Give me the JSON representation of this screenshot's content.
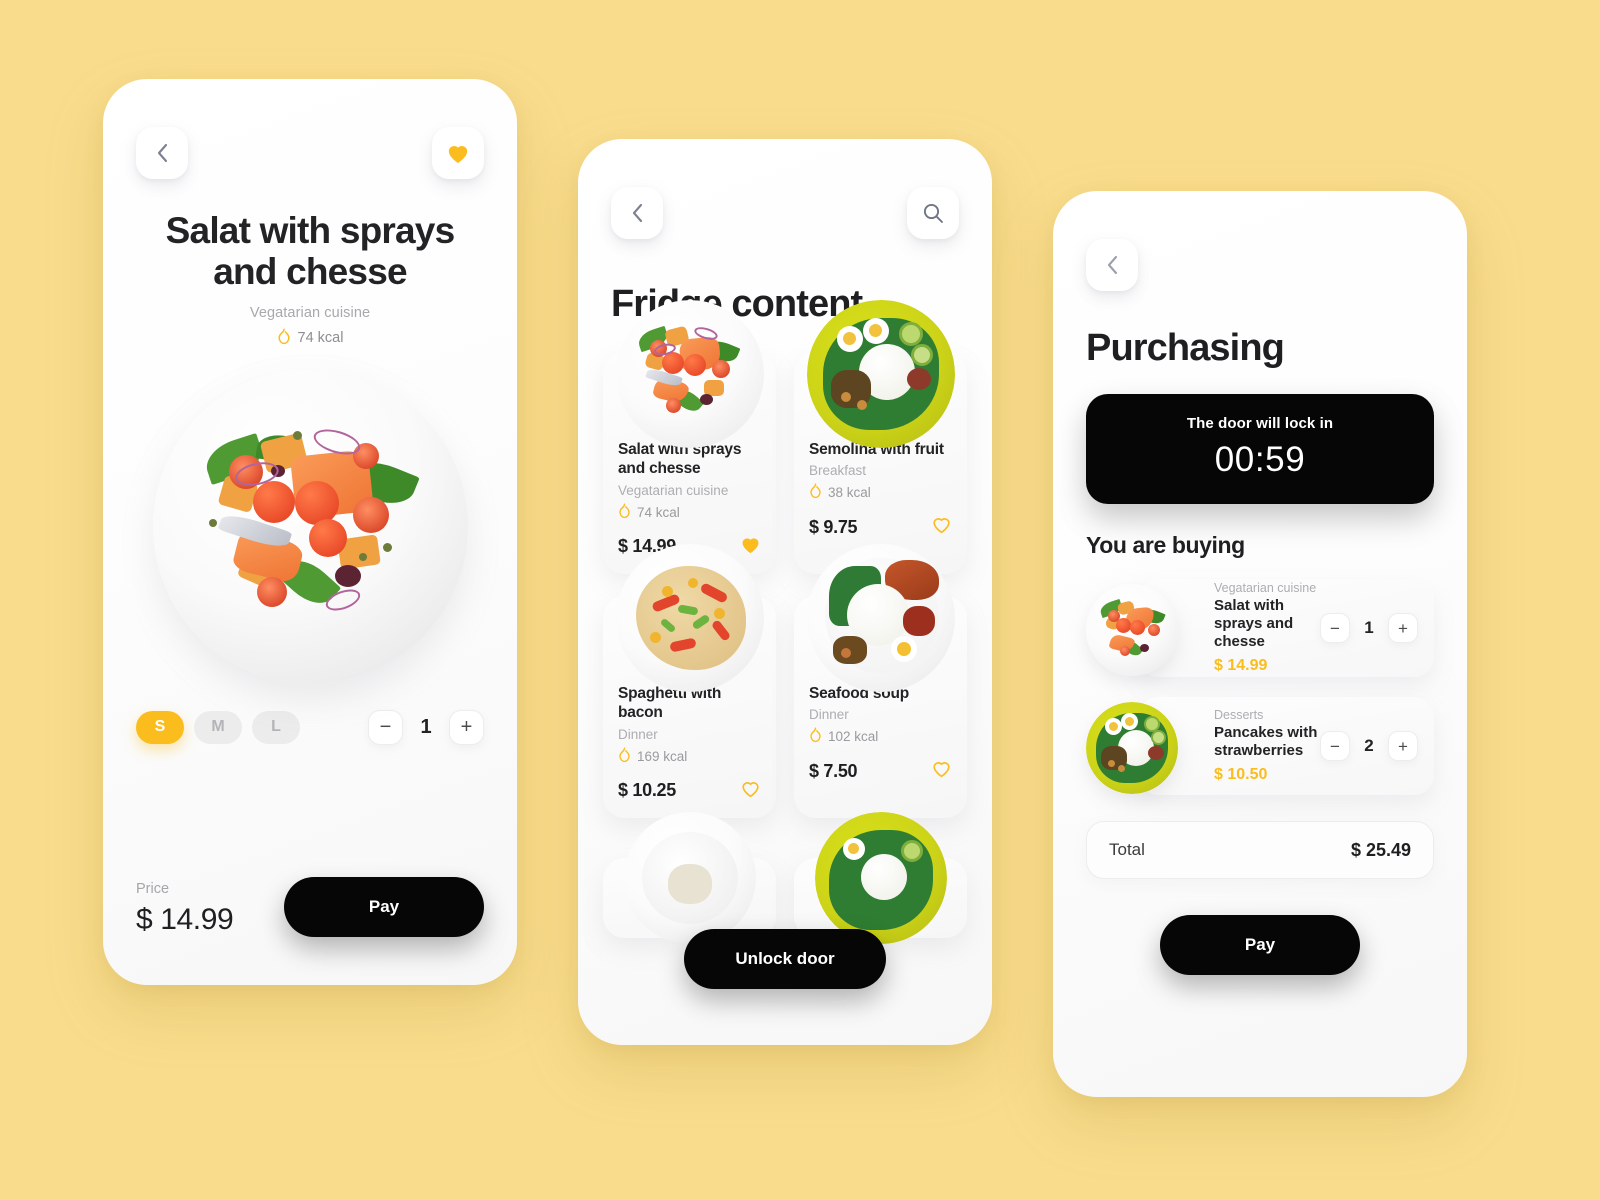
{
  "theme": {
    "background": "#f9dd8d",
    "accent": "#fbbc1e",
    "dark": "#060606",
    "text": "#232326",
    "muted": "#a8a8ad"
  },
  "detail_screen": {
    "back_icon": "chevron-left-icon",
    "favorite_icon": "heart-filled-icon",
    "title": "Salat with sprays and chesse",
    "cuisine": "Vegatarian cuisine",
    "kcal": "74 kcal",
    "kcal_icon": "flame-icon",
    "sizes": [
      {
        "label": "S",
        "active": true
      },
      {
        "label": "M",
        "active": false
      },
      {
        "label": "L",
        "active": false
      }
    ],
    "quantity": "1",
    "minus_label": "−",
    "plus_label": "+",
    "price_label": "Price",
    "price_value": "$ 14.99",
    "pay_label": "Pay"
  },
  "fridge_screen": {
    "back_icon": "chevron-left-icon",
    "search_icon": "search-icon",
    "title": "Fridge content",
    "unlock_label": "Unlock door",
    "items": [
      {
        "name": "Salat with sprays and chesse",
        "category": "Vegatarian cuisine",
        "kcal": "74 kcal",
        "price": "$ 14.99",
        "favorited": true
      },
      {
        "name": "Semolina with fruit",
        "category": "Breakfast",
        "kcal": "38 kcal",
        "price": "$ 9.75",
        "favorited": false
      },
      {
        "name": "Spaghetti with bacon",
        "category": "Dinner",
        "kcal": "169 kcal",
        "price": "$ 10.25",
        "favorited": false
      },
      {
        "name": "Seafood soup",
        "category": "Dinner",
        "kcal": "102 kcal",
        "price": "$ 7.50",
        "favorited": false
      }
    ]
  },
  "purchase_screen": {
    "back_icon": "chevron-left-icon",
    "title": "Purchasing",
    "timer_label": "The door will lock in",
    "timer_value": "00:59",
    "buying_heading": "You are buying",
    "cart": [
      {
        "category": "Vegatarian cuisine",
        "name": "Salat with sprays and chesse",
        "price": "$ 14.99",
        "quantity": "1"
      },
      {
        "category": "Desserts",
        "name": "Pancakes with strawberries",
        "price": "$ 10.50",
        "quantity": "2"
      }
    ],
    "minus_label": "−",
    "plus_label": "+",
    "total_label": "Total",
    "total_value": "$ 25.49",
    "pay_label": "Pay"
  }
}
